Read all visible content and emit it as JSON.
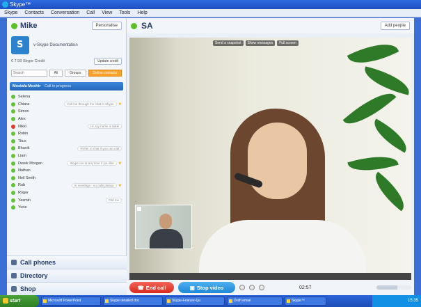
{
  "window": {
    "title": "Skype™",
    "logo_text": "skype"
  },
  "menu": [
    "Skype",
    "Contacts",
    "Conversation",
    "Call",
    "View",
    "Tools",
    "Help"
  ],
  "profile": {
    "name": "Mike",
    "button": "Personalise",
    "mood": "v-Skype Documentation",
    "credit": "€ 7.93 Skype Credit",
    "credit_button": "Update credit"
  },
  "filters": {
    "search_placeholder": "Search",
    "tabs": [
      "All",
      "Groups",
      "Online contacts"
    ]
  },
  "active_call": {
    "name": "Mostafa Moshir",
    "status": "Call in progress"
  },
  "contacts": [
    {
      "name": "Selena",
      "mood": "",
      "status": "online",
      "star": false
    },
    {
      "name": "Chiara",
      "mood": "Call me through the chat in Skype",
      "status": "online",
      "star": true
    },
    {
      "name": "Simon",
      "mood": "",
      "status": "online",
      "star": false
    },
    {
      "name": "Alex",
      "mood": "",
      "status": "online",
      "star": false
    },
    {
      "name": "Nikki",
      "mood": "Hi, my name is Nikki",
      "status": "busy",
      "star": false
    },
    {
      "name": "Robin",
      "mood": "",
      "status": "online",
      "star": false
    },
    {
      "name": "Titus",
      "mood": "",
      "status": "online",
      "star": false
    },
    {
      "name": "Bhavik",
      "mood": "Prefer to chat if you can call",
      "status": "online",
      "star": false
    },
    {
      "name": "Liam",
      "mood": "",
      "status": "online",
      "star": false
    },
    {
      "name": "Derek Morgan",
      "mood": "Skype me at any time if you like",
      "status": "online",
      "star": true
    },
    {
      "name": "Nathan",
      "mood": "",
      "status": "online",
      "star": false
    },
    {
      "name": "Neil Smith",
      "mood": "",
      "status": "online",
      "star": false
    },
    {
      "name": "Rob",
      "mood": "In meetings - no calls please",
      "status": "online",
      "star": true
    },
    {
      "name": "Roger",
      "mood": "",
      "status": "online",
      "star": false
    },
    {
      "name": "Yasmin",
      "mood": "Call me",
      "status": "online",
      "star": false
    },
    {
      "name": "Yurie",
      "mood": "",
      "status": "online",
      "star": false
    }
  ],
  "bottom_links": [
    "Call phones",
    "Directory",
    "Shop"
  ],
  "conversation": {
    "title": "SA",
    "header_button": "Add people",
    "video_tools": [
      "Send a snapshot",
      "Show messages",
      "Full screen"
    ]
  },
  "call_controls": {
    "end_call": "End call",
    "stop_video": "Stop video",
    "timer": "02:57"
  },
  "taskbar": {
    "start": "start",
    "tasks": [
      "Microsoft PowerPoint",
      "Skype detailed doc",
      "Skype-Feature-Qu",
      "Draft email",
      "Skype™"
    ],
    "clock": "15:35"
  },
  "colors": {
    "accent": "#1f87d6",
    "end_call": "#d82a1d",
    "online": "#63c13a",
    "busy": "#e23a2f"
  }
}
